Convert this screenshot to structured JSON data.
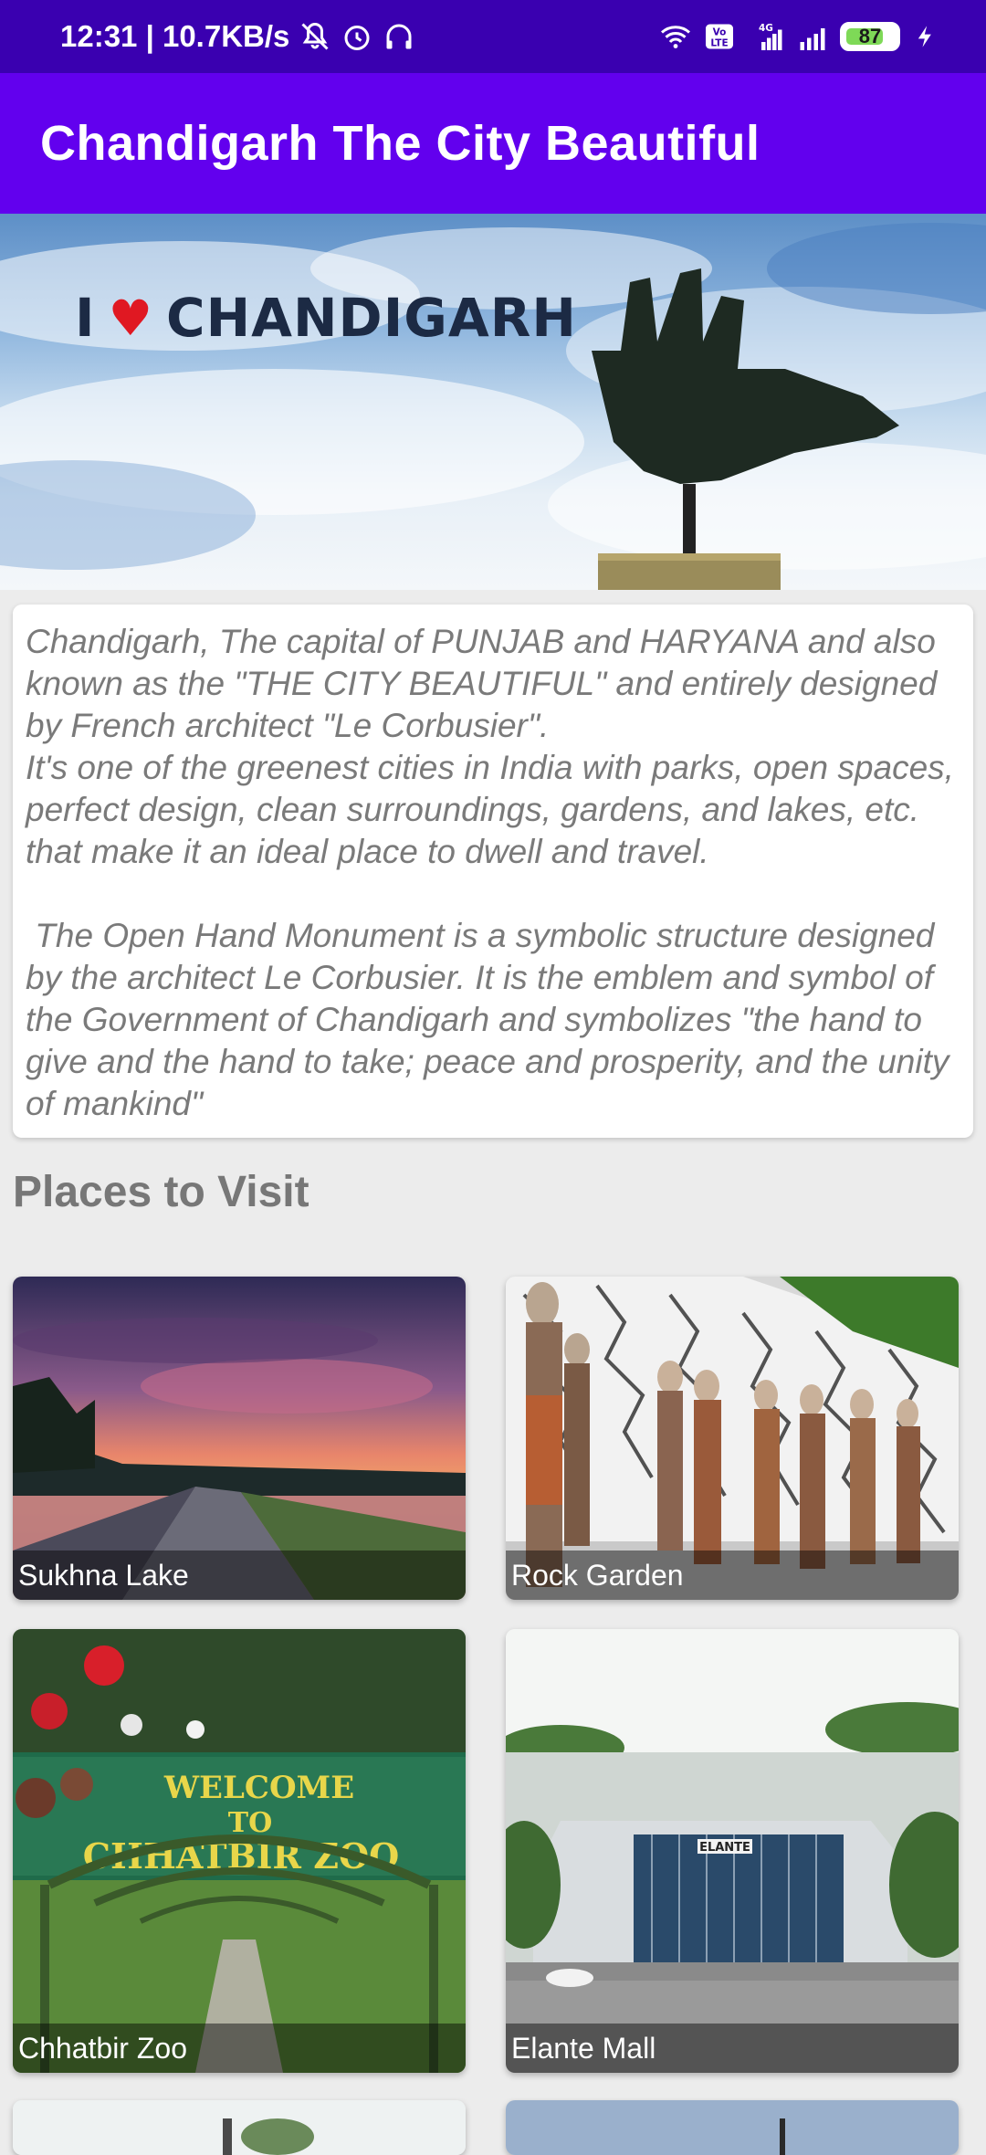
{
  "status_bar": {
    "time_speed": "12:31 | 10.7KB/s",
    "battery": "87",
    "icons": [
      "mute-icon",
      "alarm-icon",
      "headphones-icon",
      "wifi-icon",
      "volte-icon",
      "signal-4g-icon",
      "signal-icon",
      "battery-icon",
      "charging-icon"
    ]
  },
  "app_bar": {
    "title": "Chandigarh The City Beautiful"
  },
  "hero": {
    "banner_text_left": "I",
    "banner_text_right": "CHANDIGARH"
  },
  "description": {
    "text": "Chandigarh, The capital of PUNJAB and HARYANA and also known as the \"THE CITY BEAUTIFUL\" and entirely designed by French architect \"Le Corbusier\".\nIt's one of the greenest cities in India with parks, open spaces, perfect design, clean surroundings, gardens, and lakes, etc. that make it an ideal place to dwell and travel.\n\n The Open Hand Monument is a symbolic structure designed by the architect Le Corbusier. It is the emblem and symbol of the Government of Chandigarh and symbolizes \"the hand to give and the hand to take; peace and prosperity, and the unity of mankind\""
  },
  "places_section": {
    "title": "Places to Visit"
  },
  "places": [
    {
      "label": "Sukhna Lake"
    },
    {
      "label": "Rock Garden"
    },
    {
      "label": "Chhatbir Zoo",
      "sign_text": "WELCOME TO CHHATBIR ZOO"
    },
    {
      "label": "Elante Mall",
      "sign_text": "ELANTE"
    }
  ],
  "colors": {
    "status_bar": "#3a00b0",
    "app_bar": "#6200ee",
    "background": "#ececec"
  }
}
